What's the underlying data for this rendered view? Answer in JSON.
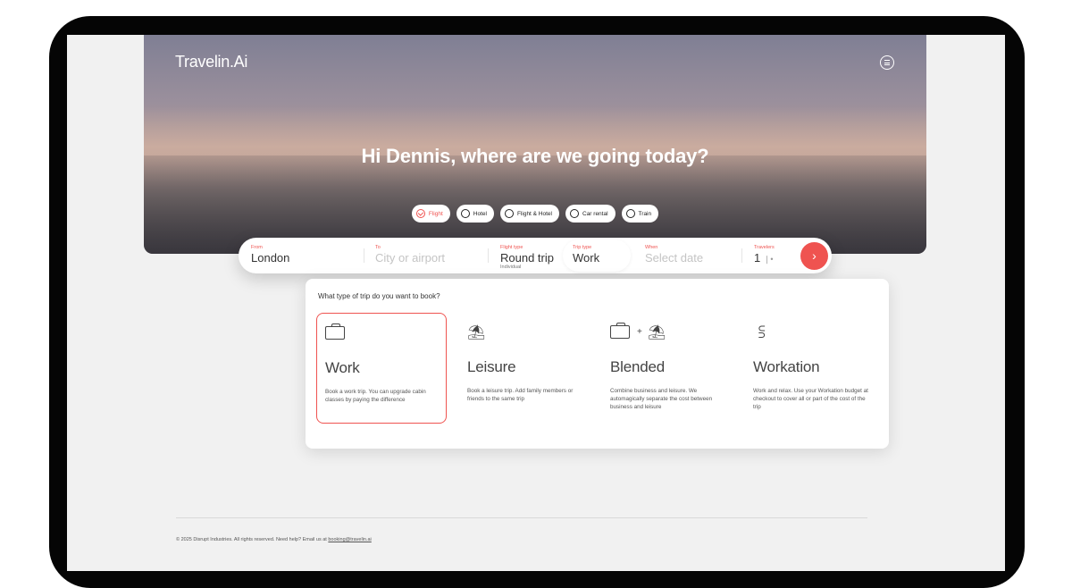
{
  "app": {
    "brand": "Travelin.Ai"
  },
  "hero": {
    "headline": "Hi Dennis, where are we going today?"
  },
  "modes": [
    {
      "label": "Flight",
      "selected": true
    },
    {
      "label": "Hotel",
      "selected": false
    },
    {
      "label": "Flight & Hotel",
      "selected": false
    },
    {
      "label": "Car rental",
      "selected": false
    },
    {
      "label": "Train",
      "selected": false
    }
  ],
  "search": {
    "from_label": "From",
    "from_value": "London",
    "to_label": "To",
    "to_placeholder": "City or airport",
    "flight_type_label": "Flight type",
    "flight_type_value": "Round trip",
    "flight_type_sub": "Individual",
    "trip_type_label": "Trip type",
    "trip_type_value": "Work",
    "when_label": "When",
    "when_placeholder": "Select date",
    "travelers_label": "Travelers",
    "travelers_value": "1",
    "go_icon": "chevron-right-icon"
  },
  "trip_panel": {
    "question": "What type of trip do you want to book?",
    "options": [
      {
        "name": "Work",
        "icon": "briefcase-icon",
        "desc": "Book a work trip. You can upgrade cabin classes by paying the difference",
        "selected": true
      },
      {
        "name": "Leisure",
        "icon": "beach-umbrella-icon",
        "desc": "Book a leisure trip. Add family members or friends to the same trip",
        "selected": false
      },
      {
        "name": "Blended",
        "icon": "briefcase-plus-umbrella-icon",
        "desc": "Combine business and leisure. We automagically separate the cost between business and leisure",
        "selected": false
      },
      {
        "name": "Workation",
        "icon": "signpost-icon",
        "desc": "Work and relax. Use your Workation budget at checkout to cover all or part of the cost of the trip",
        "selected": false
      }
    ]
  },
  "footer": {
    "text": "© 2025 Disrupt Industries. All rights reserved. Need help? Email us at",
    "email": "booking@travelin.ai"
  },
  "colors": {
    "accent": "#ef5350",
    "page_bg": "#f1f1f1"
  }
}
